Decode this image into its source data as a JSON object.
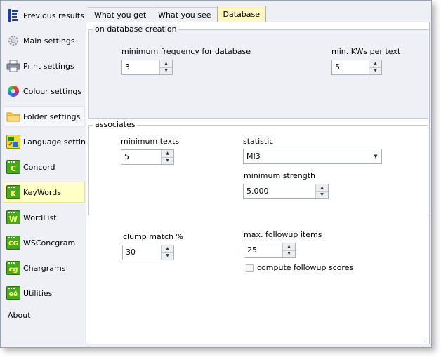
{
  "sidebar": {
    "items": [
      {
        "label": "Previous results",
        "icon": "previous-results-icon"
      },
      {
        "label": "Main settings",
        "icon": "gear-icon"
      },
      {
        "label": "Print settings",
        "icon": "printer-icon"
      },
      {
        "label": "Colour settings",
        "icon": "colour-wheel-icon"
      },
      {
        "label": "Folder settings",
        "icon": "folder-icon"
      },
      {
        "label": "Language settings",
        "icon": "language-icon"
      },
      {
        "label": "Concord",
        "icon": "concord-icon",
        "glyph": "C"
      },
      {
        "label": "KeyWords",
        "icon": "keywords-icon",
        "glyph": "K"
      },
      {
        "label": "WordList",
        "icon": "wordlist-icon",
        "glyph": "W"
      },
      {
        "label": "WSConcgram",
        "icon": "wsconcgram-icon",
        "glyph": "CG"
      },
      {
        "label": "Chargrams",
        "icon": "chargrams-icon",
        "glyph": "cg"
      },
      {
        "label": "Utilities",
        "icon": "utilities-icon",
        "glyph": "eé"
      }
    ],
    "about": "About"
  },
  "tabs": [
    {
      "label": "What you get"
    },
    {
      "label": "What you see"
    },
    {
      "label": "Database"
    }
  ],
  "database_group": {
    "title": "on database creation",
    "min_freq_label": "minimum frequency for database",
    "min_freq_value": "3",
    "min_kws_label": "min. KWs per text",
    "min_kws_value": "5"
  },
  "associates_group": {
    "title": "associates",
    "min_texts_label": "minimum texts",
    "min_texts_value": "5",
    "statistic_label": "statistic",
    "statistic_value": "MI3",
    "min_strength_label": "minimum strength",
    "min_strength_value": "5.000"
  },
  "other": {
    "clump_label": "clump match %",
    "clump_value": "30",
    "followup_label": "max. followup items",
    "followup_value": "25",
    "compute_label": "compute followup scores"
  },
  "colors": {
    "selected_bg": "#ffffc6",
    "active_tab_bg": "#fdf7c4",
    "panel_grey": "#eef0f6"
  }
}
